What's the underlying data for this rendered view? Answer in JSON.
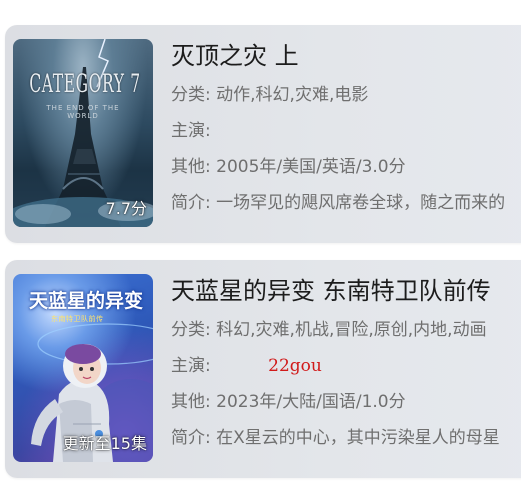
{
  "items": [
    {
      "title": "灭顶之灾 上",
      "category_label": "分类:",
      "category_value": "动作,科幻,灾难,电影",
      "cast_label": "主演:",
      "cast_value": "",
      "other_label": "其他:",
      "other_value": "2005年/美国/英语/3.0分",
      "intro_label": "简介:",
      "intro_value": "一场罕见的飓风席卷全球，随之而来的",
      "badge": "7.7分",
      "poster_art_title": "CATEGORY 7",
      "poster_art_subtitle": "THE END OF THE WORLD"
    },
    {
      "title": "天蓝星的异变 东南特卫队前传",
      "category_label": "分类:",
      "category_value": "科幻,灾难,机战,冒险,原创,内地,动画",
      "cast_label": "主演:",
      "cast_value": "22gou",
      "other_label": "其他:",
      "other_value": "2023年/大陆/国语/1.0分",
      "intro_label": "简介:",
      "intro_value": "在X星云的中心，其中污染星人的母星",
      "badge": "更新至15集",
      "poster_art_title": "天蓝星的异变",
      "poster_art_subtitle": "东南特卫队前传"
    }
  ]
}
